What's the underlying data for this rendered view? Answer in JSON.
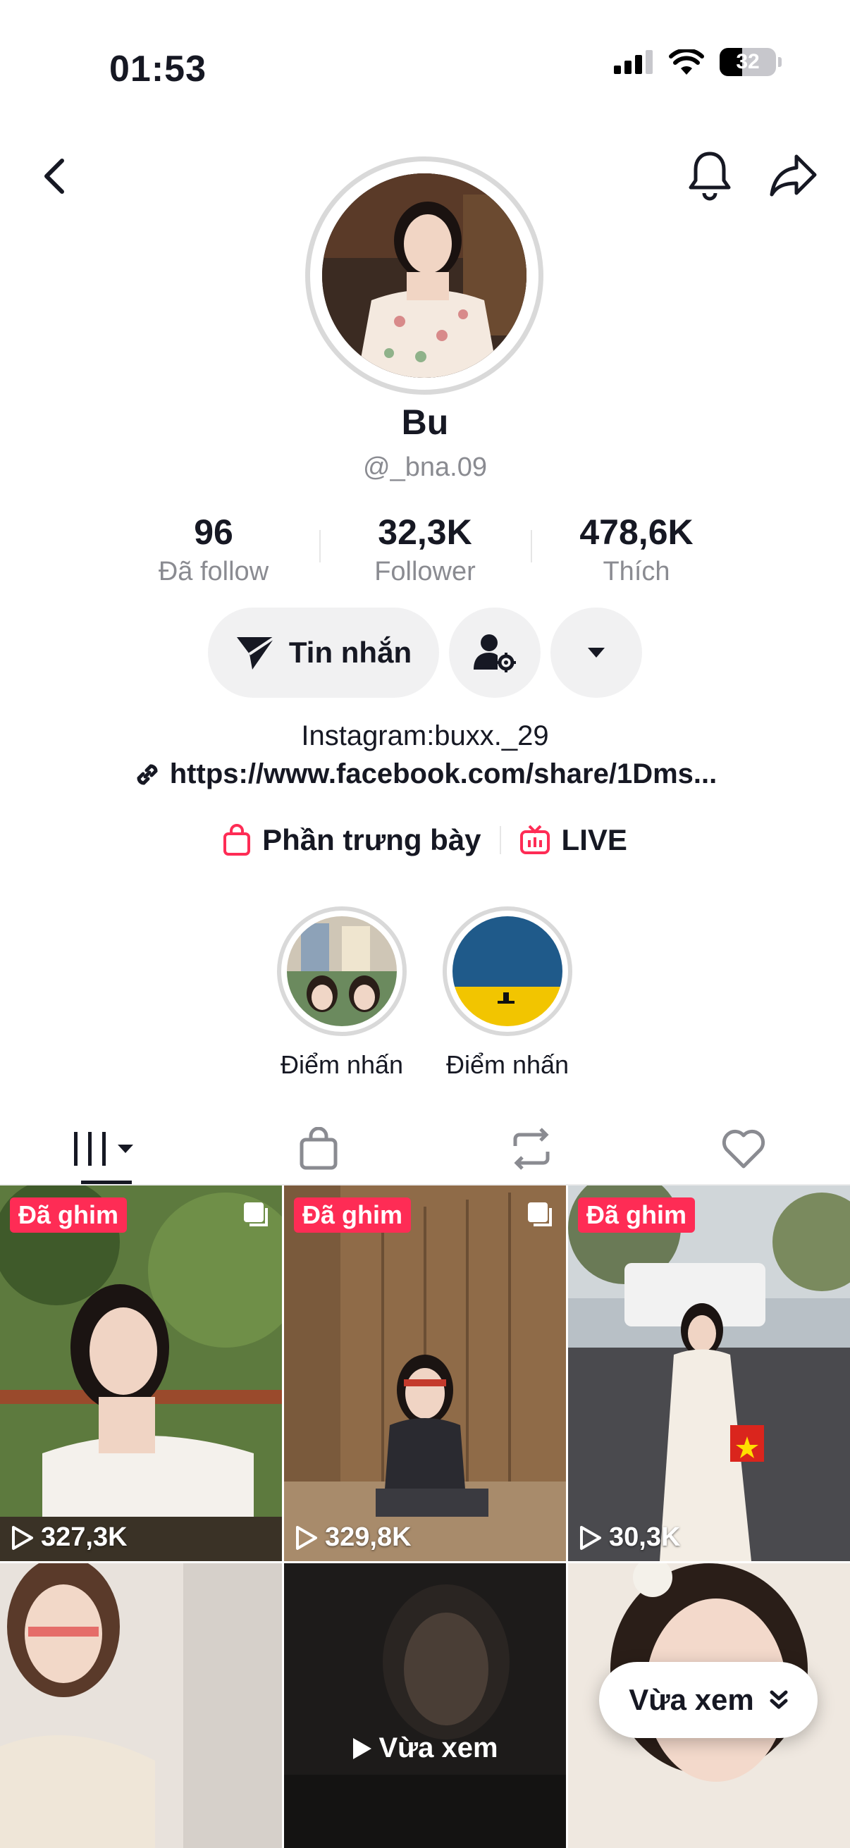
{
  "status": {
    "time": "01:53",
    "battery": "32"
  },
  "profile": {
    "name": "Bu",
    "handle": "@_bna.09",
    "stats": [
      {
        "value": "96",
        "label": "Đã follow"
      },
      {
        "value": "32,3K",
        "label": "Follower"
      },
      {
        "value": "478,6K",
        "label": "Thích"
      }
    ],
    "message_label": "Tin nhắn",
    "bio": "Instagram:buxx._29",
    "link": "https://www.facebook.com/share/1Dms...",
    "showcase_label": "Phần trưng bày",
    "live_label": "LIVE"
  },
  "highlights": [
    {
      "label": "Điểm nhấn"
    },
    {
      "label": "Điểm nhấn"
    }
  ],
  "videos": [
    {
      "pinned": "Đã ghim",
      "views": "327,3K"
    },
    {
      "pinned": "Đã ghim",
      "views": "329,8K"
    },
    {
      "pinned": "Đã ghim",
      "views": "30,3K"
    },
    {
      "overlay": ""
    },
    {
      "overlay": "Vừa xem"
    },
    {
      "overlay": ""
    }
  ],
  "floating": {
    "label": "Vừa xem"
  },
  "colors": {
    "accent": "#fe2c55",
    "text": "#161823",
    "muted": "#8a8b91"
  }
}
